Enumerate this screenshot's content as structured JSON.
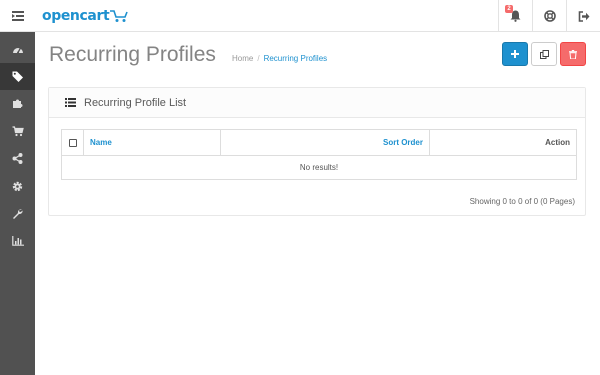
{
  "header": {
    "logo_text": "opencart",
    "alert_count": "2",
    "icons": {
      "menu": "menu-toggle-icon",
      "alerts": "bell-icon",
      "help": "life-ring-icon",
      "logout": "sign-out-icon"
    }
  },
  "sidebar": {
    "items": [
      {
        "icon": "dashboard-icon",
        "active": false
      },
      {
        "icon": "tag-icon",
        "active": true
      },
      {
        "icon": "puzzle-icon",
        "active": false
      },
      {
        "icon": "shopping-cart-icon",
        "active": false
      },
      {
        "icon": "share-icon",
        "active": false
      },
      {
        "icon": "cog-icon",
        "active": false
      },
      {
        "icon": "wrench-icon",
        "active": false
      },
      {
        "icon": "bar-chart-icon",
        "active": false
      }
    ]
  },
  "page": {
    "title": "Recurring Profiles",
    "breadcrumb": {
      "home": "Home",
      "separator": "/",
      "current": "Recurring Profiles"
    },
    "actions": {
      "add": "plus-icon",
      "copy": "copy-icon",
      "delete": "trash-icon"
    }
  },
  "panel": {
    "title": "Recurring Profile List",
    "table": {
      "columns": [
        "Name",
        "Sort Order",
        "Action"
      ],
      "empty_message": "No results!"
    },
    "pagination_text": "Showing 0 to 0 of 0 (0 Pages)"
  },
  "colors": {
    "brand_blue": "#1e91cf",
    "sidebar_bg": "#515151",
    "sidebar_active": "#383838",
    "danger": "#f56b6b"
  }
}
